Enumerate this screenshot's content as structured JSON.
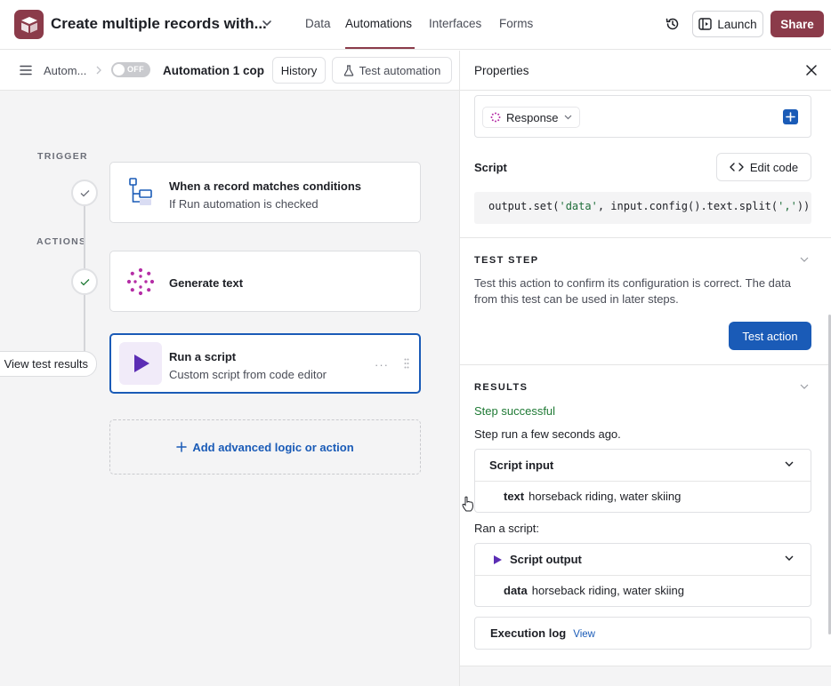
{
  "topbar": {
    "base_name": "Create multiple records with...",
    "tabs": [
      {
        "label": "Data"
      },
      {
        "label": "Automations"
      },
      {
        "label": "Interfaces"
      },
      {
        "label": "Forms"
      }
    ],
    "launch_label": "Launch",
    "share_label": "Share",
    "brand_color": "#8b3b4a"
  },
  "subbar": {
    "breadcrumb": "Autom...",
    "toggle_label": "OFF",
    "automation_name": "Automation 1 cop",
    "history_label": "History",
    "test_label": "Test automation"
  },
  "canvas": {
    "trigger_label": "TRIGGER",
    "actions_label": "ACTIONS",
    "trigger_card": {
      "title": "When a record matches conditions",
      "subtitle": "If Run automation is checked"
    },
    "generate_card": {
      "title": "Generate text"
    },
    "script_card": {
      "title": "Run a script",
      "subtitle": "Custom script from code editor",
      "more": "···"
    },
    "view_results_label": "View test results",
    "add_label": "Add advanced logic or action"
  },
  "panel": {
    "title": "Properties",
    "response_label": "Response",
    "script_label": "Script",
    "edit_code_label": "Edit code",
    "code": {
      "p1": "output.set(",
      "s1": "'data'",
      "p2": ", input.config().text.split(",
      "s2": "','",
      "p3": "))"
    },
    "test_step": {
      "heading": "TEST STEP",
      "description": "Test this action to confirm its configuration is correct. The data from this test can be used in later steps.",
      "button": "Test action"
    },
    "results": {
      "heading": "RESULTS",
      "status": "Step successful",
      "time": "Step run a few seconds ago.",
      "input_box": {
        "title": "Script input",
        "key": "text",
        "value": "horseback riding, water skiing"
      },
      "ran_label": "Ran a script:",
      "output_box": {
        "title": "Script output",
        "key": "data",
        "value": "horseback riding, water skiing"
      },
      "log_box": {
        "title": "Execution log",
        "link": "View"
      }
    }
  }
}
